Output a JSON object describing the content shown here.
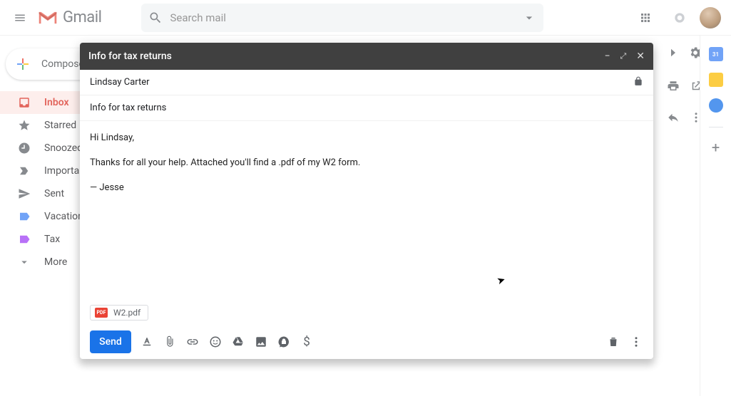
{
  "header": {
    "logo_text": "Gmail",
    "search_placeholder": "Search mail"
  },
  "compose_button_label": "Compose",
  "sidebar": {
    "items": [
      {
        "label": "Inbox"
      },
      {
        "label": "Starred"
      },
      {
        "label": "Snoozed"
      },
      {
        "label": "Important"
      },
      {
        "label": "Sent"
      },
      {
        "label": "Vacation"
      },
      {
        "label": "Tax"
      },
      {
        "label": "More"
      }
    ]
  },
  "sidepanel": {
    "calendar_day": "31"
  },
  "dialog": {
    "title": "Info for tax returns",
    "to": "Lindsay Carter",
    "subject": "Info for tax returns",
    "body_lines": [
      "Hi Lindsay,",
      "Thanks for all your help. Attached you'll find a .pdf of my W2 form.",
      "— Jesse"
    ],
    "attachment": {
      "name": "W2.pdf",
      "badge": "PDF"
    },
    "send_label": "Send"
  }
}
